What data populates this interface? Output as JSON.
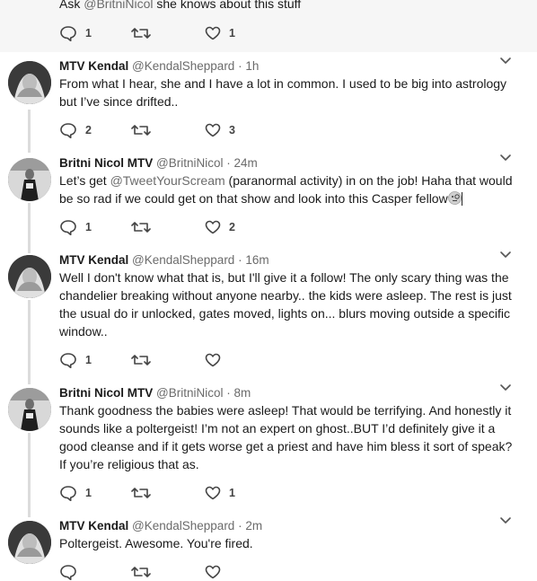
{
  "tweets": [
    {
      "body_parts": [
        {
          "text": "Ask ",
          "mention": false
        },
        {
          "text": "@BritniNicol",
          "mention": true
        },
        {
          "text": " she knows about this stuff",
          "mention": false
        }
      ],
      "replies": "1",
      "retweets": "",
      "likes": "1"
    },
    {
      "name": "MTV Kendal",
      "handle": "@KendalSheppard",
      "time": "1h",
      "body": "From what I hear, she and I have a lot in common. I used to be big into astrology but I’ve since drifted..",
      "replies": "2",
      "retweets": "",
      "likes": "3"
    },
    {
      "name": "Britni Nicol MTV",
      "handle": "@BritniNicol",
      "time": "24m",
      "body_parts": [
        {
          "text": "Let’s get ",
          "mention": false
        },
        {
          "text": "@TweetYourScream",
          "mention": true
        },
        {
          "text": " (paranormal activity) in on the job! Haha that would be so rad if we could get on that show and look into this Casper fellow",
          "mention": false
        }
      ],
      "replies": "1",
      "retweets": "",
      "likes": "2"
    },
    {
      "name": "MTV Kendal",
      "handle": "@KendalSheppard",
      "time": "16m",
      "body": "Well I don't know what that is, but I'll give it a follow! The only scary thing was the chandelier breaking without anyone nearby.. the kids were asleep. The rest is just the usual do ir unlocked, gates moved, lights on...  blurs moving outside a specific window..",
      "replies": "1",
      "retweets": "",
      "likes": ""
    },
    {
      "name": "Britni Nicol MTV",
      "handle": "@BritniNicol",
      "time": "8m",
      "body": "Thank goodness the babies were asleep! That would be terrifying. And honestly it sounds like a poltergeist! I’m not an expert on ghost..BUT I’d definitely give it a good cleanse and if it gets worse get a priest and have him bless it sort of speak? If you’re religious that as.",
      "replies": "1",
      "retweets": "",
      "likes": "1"
    },
    {
      "name": "MTV Kendal",
      "handle": "@KendalSheppard",
      "time": "2m",
      "body": "Poltergeist. Awesome. You're fired.",
      "replies": "",
      "retweets": "",
      "likes": ""
    }
  ],
  "separator": "·",
  "icons": {
    "reply": "reply-bubble-icon",
    "retweet": "retweet-icon",
    "like": "heart-icon",
    "more": "chevron-down-icon",
    "emoji": "monocle-face-emoji-icon"
  },
  "colors": {
    "text": "#1a1a1a",
    "muted": "#6b6b6b",
    "thread_line": "#dcdcdc",
    "first_bg": "#f6f6f6"
  }
}
